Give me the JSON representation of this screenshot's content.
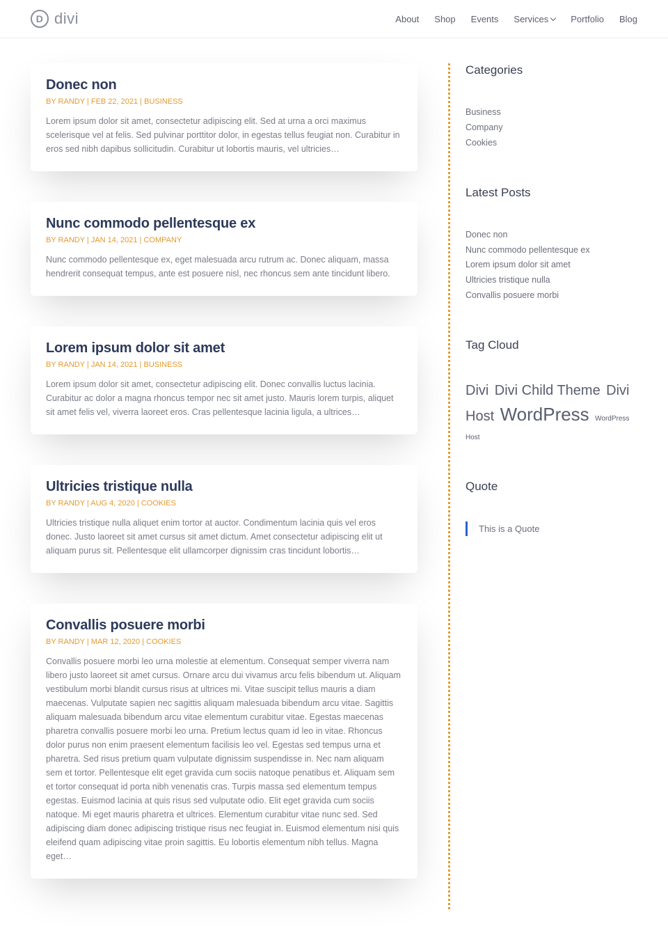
{
  "brand": {
    "name": "divi",
    "logo_letter": "D"
  },
  "nav": {
    "items": [
      "About",
      "Shop",
      "Events",
      "Services",
      "Portfolio",
      "Blog"
    ]
  },
  "posts": [
    {
      "title": "Donec non",
      "by": "BY",
      "author": "RANDY",
      "date": "FEB 22, 2021",
      "category": "BUSINESS",
      "excerpt": "Lorem ipsum dolor sit amet, consectetur adipiscing elit. Sed at urna a orci maximus scelerisque vel at felis. Sed pulvinar porttitor dolor, in egestas tellus feugiat non. Curabitur in eros sed nibh dapibus sollicitudin. Curabitur ut lobortis mauris, vel ultricies…"
    },
    {
      "title": "Nunc commodo pellentesque ex",
      "by": "BY",
      "author": "RANDY",
      "date": "JAN 14, 2021",
      "category": "COMPANY",
      "excerpt": "Nunc commodo pellentesque ex, eget malesuada arcu rutrum ac. Donec aliquam, massa hendrerit consequat tempus, ante est posuere nisl, nec rhoncus sem ante tincidunt libero."
    },
    {
      "title": "Lorem ipsum dolor sit amet",
      "by": "BY",
      "author": "RANDY",
      "date": "JAN 14, 2021",
      "category": "BUSINESS",
      "excerpt": "Lorem ipsum dolor sit amet, consectetur adipiscing elit. Donec convallis luctus lacinia. Curabitur ac dolor a magna rhoncus tempor nec sit amet justo. Mauris lorem turpis, aliquet sit amet felis vel, viverra laoreet eros. Cras pellentesque lacinia ligula, a ultrices…"
    },
    {
      "title": "Ultricies tristique nulla",
      "by": "BY",
      "author": "RANDY",
      "date": "AUG 4, 2020",
      "category": "COOKIES",
      "excerpt": "Ultricies tristique nulla aliquet enim tortor at auctor. Condimentum lacinia quis vel eros donec. Justo laoreet sit amet cursus sit amet dictum. Amet consectetur adipiscing elit ut aliquam purus sit. Pellentesque elit ullamcorper dignissim cras tincidunt lobortis…"
    },
    {
      "title": "Convallis posuere morbi",
      "by": "BY",
      "author": "RANDY",
      "date": "MAR 12, 2020",
      "category": "COOKIES",
      "excerpt": "Convallis posuere morbi leo urna molestie at elementum. Consequat semper viverra nam libero justo laoreet sit amet cursus. Ornare arcu dui vivamus arcu felis bibendum ut. Aliquam vestibulum morbi blandit cursus risus at ultrices mi. Vitae suscipit tellus mauris a diam maecenas. Vulputate sapien nec sagittis aliquam malesuada bibendum arcu vitae. Sagittis aliquam malesuada bibendum arcu vitae elementum curabitur vitae. Egestas maecenas pharetra convallis posuere morbi leo urna. Pretium lectus quam id leo in vitae. Rhoncus dolor purus non enim praesent elementum facilisis leo vel. Egestas sed tempus urna et pharetra. Sed risus pretium quam vulputate dignissim suspendisse in. Nec nam aliquam sem et tortor. Pellentesque elit eget gravida cum sociis natoque penatibus et. Aliquam sem et tortor consequat id porta nibh venenatis cras. Turpis massa sed elementum tempus egestas. Euismod lacinia at quis risus sed vulputate odio. Elit eget gravida cum sociis natoque. Mi eget mauris pharetra et ultrices. Elementum curabitur vitae nunc sed. Sed adipiscing diam donec adipiscing tristique risus nec feugiat in. Euismod elementum nisi quis eleifend quam adipiscing vitae proin sagittis. Eu lobortis elementum nibh tellus. Magna eget…"
    }
  ],
  "sidebar": {
    "categories_title": "Categories",
    "categories": [
      "Business",
      "Company",
      "Cookies"
    ],
    "latest_title": "Latest Posts",
    "latest": [
      "Donec non",
      "Nunc commodo pellentesque ex",
      "Lorem ipsum dolor sit amet",
      "Ultricies tristique nulla",
      "Convallis posuere morbi"
    ],
    "tagcloud_title": "Tag Cloud",
    "tags": [
      {
        "label": "Divi",
        "size": "tag-lg"
      },
      {
        "label": "Divi Child Theme",
        "size": "tag-lg"
      },
      {
        "label": "Divi Host",
        "size": "tag-lg"
      },
      {
        "label": "WordPress",
        "size": "tag-xl"
      },
      {
        "label": "WordPress Host",
        "size": "tag-sm"
      }
    ],
    "quote_title": "Quote",
    "quote_text": "This is a Quote"
  }
}
